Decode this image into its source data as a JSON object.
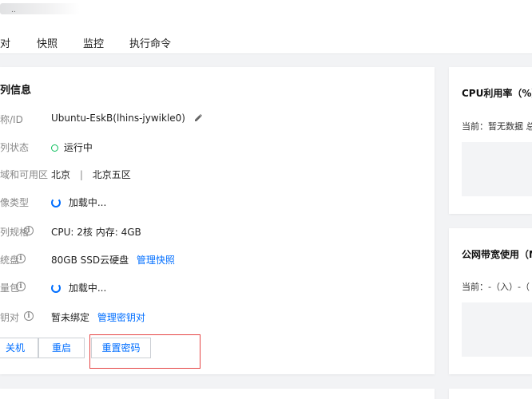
{
  "top": {
    "blurred_text": "..",
    "tabs": [
      "对",
      "快照",
      "监控",
      "执行命令"
    ]
  },
  "instance": {
    "title": "列信息",
    "rows": [
      {
        "label": "称/ID",
        "value": "Ubuntu-EskB(lhins-jywikle0)"
      },
      {
        "label": "列状态",
        "value": "运行中"
      },
      {
        "label": "域和可用区",
        "region": "北京",
        "separator": "|",
        "zone": "北京五区"
      },
      {
        "label": "像类型",
        "value": "加载中..."
      },
      {
        "label": "列规格",
        "value": "CPU: 2核 内存: 4GB"
      },
      {
        "label": "统盘",
        "value": "80GB SSD云硬盘",
        "link": "管理快照"
      },
      {
        "label": "量包",
        "value": "加载中..."
      },
      {
        "label": "钥对",
        "value": "暂未绑定",
        "link": "管理密钥对"
      }
    ],
    "buttons": {
      "shutdown": "关机",
      "restart": "重启",
      "reset_password": "重置密码"
    }
  },
  "monitor": {
    "cpu": {
      "title": "CPU利用率（%）",
      "current": "当前：暂无数据 总览"
    },
    "bandwidth": {
      "title": "公网带宽使用（M",
      "current": "当前：-（入）-（"
    }
  },
  "colors": {
    "accent": "#006eff",
    "running": "#0abf5b",
    "highlight_box": "#e54545"
  }
}
